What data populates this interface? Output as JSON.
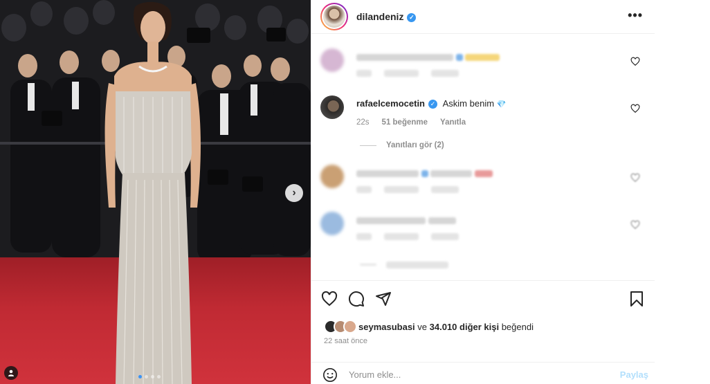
{
  "post": {
    "owner_username": "dilandeniz",
    "more_label": "•••"
  },
  "comments": [
    {
      "blurred": true,
      "ava_color": "#c9a7c8"
    },
    {
      "blurred": false,
      "username": "rafaelcemocetin",
      "text": "Askim benim",
      "emoji": "💎",
      "age": "22s",
      "likes": "51 beğenme",
      "reply_label": "Yanıtla"
    },
    {
      "blurred": true,
      "ava_color": "#c59b6a"
    },
    {
      "blurred": true,
      "ava_color": "#8fb2d6"
    }
  ],
  "see_replies": "Yanıtları gör (2)",
  "likes_line": {
    "first_user": "seymasubasi",
    "connector": " ve ",
    "others": "34.010 diğer kişi",
    "suffix": " beğendi"
  },
  "time_ago": "22 saat önce",
  "comment_input": {
    "placeholder": "Yorum ekle...",
    "share_label": "Paylaş"
  },
  "colors": {
    "verified": "#3897f0",
    "share_disabled": "#b2dffc",
    "carpet": "#c52a32"
  },
  "icons": [
    "more-icon",
    "heart-icon",
    "comment-icon",
    "share-icon",
    "bookmark-icon",
    "emoji-icon",
    "next-arrow-icon",
    "tag-user-icon"
  ]
}
